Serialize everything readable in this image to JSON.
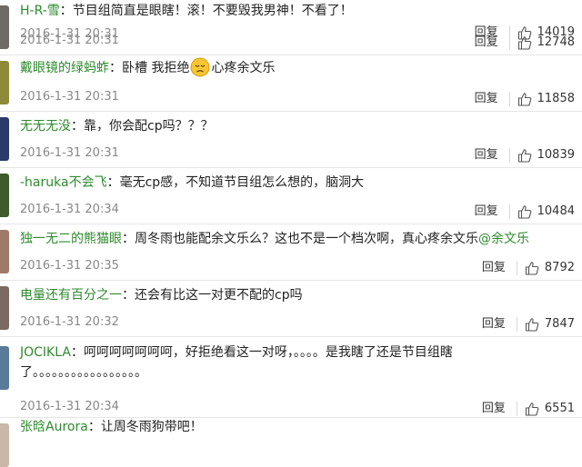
{
  "comments": [
    {
      "username": "H-R-雪",
      "separator": "：",
      "text": "节目组简直是眼瞎！滚！不要毁我男神！不看了！",
      "time": "2016-1-31 20:31",
      "reply_label": "回复",
      "likes": "14019",
      "avatar_color": "#6e6a66"
    },
    {
      "username": "戴眼镜的绿蚂蚱",
      "separator": "：",
      "text_before": "卧槽 我拒绝",
      "emoji": "worried-emoji",
      "text_after": "心疼余文乐",
      "time": "2016-1-31 20:31",
      "reply_label": "回复",
      "likes": "12748",
      "avatar_color": "#8d8a3a"
    },
    {
      "username": "无无无没",
      "separator": "：",
      "text": "靠，你会配cp吗？？？",
      "time": "2016-1-31 20:31",
      "reply_label": "回复",
      "likes": "11858",
      "avatar_color": "#2b3a6b"
    },
    {
      "username": "-haruka不会飞",
      "separator": "：",
      "text": "毫无cp感，不知道节目组怎么想的，脑洞大",
      "time": "2016-1-31 20:31",
      "reply_label": "回复",
      "likes": "10839",
      "avatar_color": "#3f5a2c"
    },
    {
      "username": "独一无二的熊猫眼",
      "separator": "：",
      "text": "周冬雨也能配余文乐么？这也不是一个档次啊，真心疼余文乐",
      "mention": "@余文乐",
      "time": "2016-1-31 20:34",
      "reply_label": "回复",
      "likes": "10484",
      "avatar_color": "#a07a68"
    },
    {
      "username": "电量还有百分之一",
      "separator": "：",
      "text": "还会有比这一对更不配的cp吗",
      "time": "2016-1-31 20:35",
      "reply_label": "回复",
      "likes": "8792",
      "avatar_color": "#7a6a62"
    },
    {
      "username": "JOCIKLA",
      "separator": "：",
      "text": "呵呵呵呵呵呵呵，好拒绝看这一对呀，。。。。是我瞎了还是节目组瞎了。。。。。。。。。。。。。。。。。",
      "time": "2016-1-31 20:32",
      "reply_label": "回复",
      "likes": "7847",
      "avatar_color": "#5a7a9a"
    },
    {
      "username": "张晗Aurora",
      "separator": "：",
      "text": "让周冬雨狗带吧！",
      "time": "2016-1-31 20:34",
      "reply_label": "回复",
      "likes": "6551",
      "avatar_color": "#c9b8a8"
    }
  ]
}
